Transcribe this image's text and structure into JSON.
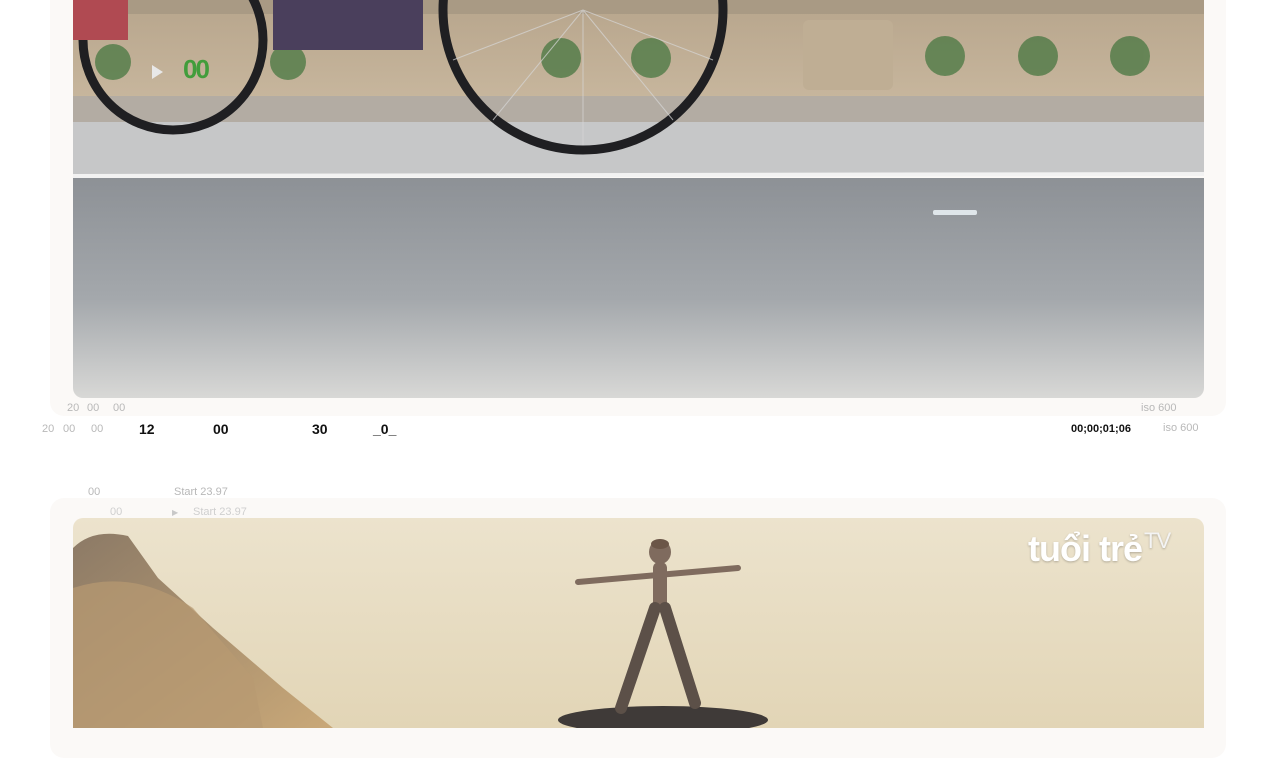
{
  "top_panel": {
    "overlay_indicator": "00",
    "header_left": [
      "20",
      "00",
      "00"
    ],
    "header_right": "iso 600",
    "timecodes": [
      "12",
      "00",
      "30",
      "_0_"
    ],
    "row_left": [
      "20",
      "00",
      "00"
    ],
    "duration": "00;00;01;06",
    "iso": "iso 600"
  },
  "bottom_panel": {
    "header_frame": "00",
    "header_start": "Start 23.97",
    "sub_frame": "00",
    "sub_start": "Start 23.97",
    "logo_main": "tuổi trẻ",
    "logo_suffix": "TV"
  },
  "colors": {
    "indicator_green": "#2c9a2c",
    "card_bg": "#fbf9f7",
    "road_gray": "#9a9ea3",
    "sky_cream": "#e7dcc3"
  },
  "icons": [
    "play-icon"
  ]
}
